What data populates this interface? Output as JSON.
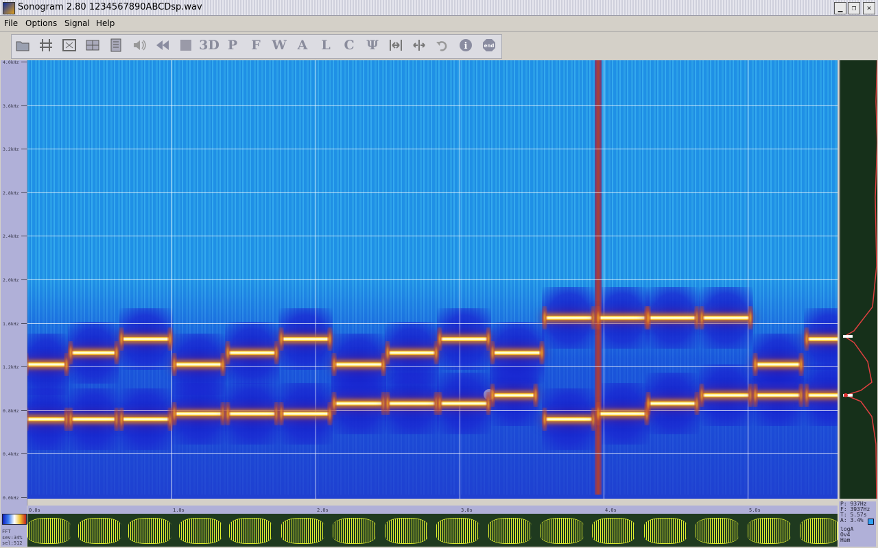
{
  "window": {
    "title": "Sonogram 2.80  1234567890ABCDsp.wav",
    "buttons": [
      "minimize-icon",
      "restore-icon",
      "close-icon"
    ]
  },
  "menu": [
    {
      "label": "File"
    },
    {
      "label": "Options"
    },
    {
      "label": "Signal"
    },
    {
      "label": "Help"
    }
  ],
  "toolbar": [
    {
      "icon": "open-file-icon",
      "label": ""
    },
    {
      "icon": "settings-icon",
      "label": ""
    },
    {
      "icon": "fit-window-icon",
      "label": ""
    },
    {
      "icon": "layout-icon",
      "label": ""
    },
    {
      "icon": "list-icon",
      "label": ""
    },
    {
      "icon": "speaker-icon",
      "label": ""
    },
    {
      "icon": "rewind-icon",
      "label": ""
    },
    {
      "icon": "stop-icon",
      "label": ""
    },
    {
      "icon": "3d-icon",
      "label": "3D"
    },
    {
      "icon": "p-icon",
      "label": "P"
    },
    {
      "icon": "f-icon",
      "label": "F"
    },
    {
      "icon": "w-icon",
      "label": "W"
    },
    {
      "icon": "a-icon",
      "label": "A"
    },
    {
      "icon": "l-icon",
      "label": "L"
    },
    {
      "icon": "c-icon",
      "label": "C"
    },
    {
      "icon": "psi-icon",
      "label": "Ψ"
    },
    {
      "icon": "zoom-in-icon",
      "label": ""
    },
    {
      "icon": "zoom-out-icon",
      "label": ""
    },
    {
      "icon": "undo-icon",
      "label": ""
    },
    {
      "icon": "info-icon",
      "label": "i"
    },
    {
      "icon": "end-icon",
      "label": "end"
    }
  ],
  "yaxis": {
    "ticks": [
      "4.0kHz",
      "3.6kHz",
      "3.2kHz",
      "2.8kHz",
      "2.4kHz",
      "2.0kHz",
      "1.6kHz",
      "1.2kHz",
      "0.8kHz",
      "0.4kHz",
      "0.0kHz"
    ]
  },
  "timeaxis": {
    "ticks": [
      "0.0s",
      "1.0s",
      "2.0s",
      "3.0s",
      "4.0s",
      "5.0s"
    ]
  },
  "readout": {
    "f_peak": "P: 937Hz",
    "f_cursor": "F: 3937Hz",
    "time": "T: 5.57s",
    "amp": "A: 3.4%",
    "scale": "logA",
    "overlap": "Ov4",
    "window": "Ham"
  },
  "leftinfo": {
    "label": "FFT",
    "line1": "sev:34%",
    "line2": "sel:512"
  },
  "tones": {
    "high": [
      {
        "t": 0.0,
        "len": 0.26,
        "f": 1.22
      },
      {
        "t": 0.31,
        "len": 0.3,
        "f": 1.33
      },
      {
        "t": 0.66,
        "len": 0.32,
        "f": 1.45
      },
      {
        "t": 1.03,
        "len": 0.32,
        "f": 1.22
      },
      {
        "t": 1.4,
        "len": 0.32,
        "f": 1.33
      },
      {
        "t": 1.77,
        "len": 0.32,
        "f": 1.45
      },
      {
        "t": 2.14,
        "len": 0.32,
        "f": 1.22
      },
      {
        "t": 2.51,
        "len": 0.32,
        "f": 1.33
      },
      {
        "t": 2.87,
        "len": 0.32,
        "f": 1.45
      },
      {
        "t": 3.24,
        "len": 0.32,
        "f": 1.33
      },
      {
        "t": 3.6,
        "len": 0.32,
        "f": 1.65
      },
      {
        "t": 3.97,
        "len": 0.32,
        "f": 1.65
      },
      {
        "t": 4.32,
        "len": 0.32,
        "f": 1.65
      },
      {
        "t": 4.69,
        "len": 0.32,
        "f": 1.65
      },
      {
        "t": 5.06,
        "len": 0.3,
        "f": 1.22
      },
      {
        "t": 5.42,
        "len": 0.3,
        "f": 1.45
      }
    ],
    "low": [
      {
        "t": 0.0,
        "len": 0.26,
        "f": 0.72
      },
      {
        "t": 0.31,
        "len": 0.3,
        "f": 0.72
      },
      {
        "t": 0.66,
        "len": 0.32,
        "f": 0.72
      },
      {
        "t": 1.03,
        "len": 0.32,
        "f": 0.77
      },
      {
        "t": 1.4,
        "len": 0.32,
        "f": 0.77
      },
      {
        "t": 1.77,
        "len": 0.32,
        "f": 0.77
      },
      {
        "t": 2.14,
        "len": 0.32,
        "f": 0.86
      },
      {
        "t": 2.51,
        "len": 0.32,
        "f": 0.86
      },
      {
        "t": 2.87,
        "len": 0.32,
        "f": 0.86
      },
      {
        "t": 3.24,
        "len": 0.28,
        "f": 0.94
      },
      {
        "t": 3.6,
        "len": 0.32,
        "f": 0.72
      },
      {
        "t": 3.97,
        "len": 0.32,
        "f": 0.77
      },
      {
        "t": 4.32,
        "len": 0.32,
        "f": 0.86
      },
      {
        "t": 4.69,
        "len": 0.32,
        "f": 0.94
      },
      {
        "t": 5.06,
        "len": 0.3,
        "f": 0.94
      },
      {
        "t": 5.42,
        "len": 0.3,
        "f": 0.94
      }
    ]
  },
  "waveform_segments": [
    {
      "t": 0.0,
      "len": 0.3
    },
    {
      "t": 0.35,
      "len": 0.3
    },
    {
      "t": 0.7,
      "len": 0.3
    },
    {
      "t": 1.05,
      "len": 0.3
    },
    {
      "t": 1.4,
      "len": 0.3
    },
    {
      "t": 1.76,
      "len": 0.3
    },
    {
      "t": 2.12,
      "len": 0.3
    },
    {
      "t": 2.48,
      "len": 0.3
    },
    {
      "t": 2.84,
      "len": 0.3
    },
    {
      "t": 3.2,
      "len": 0.3
    },
    {
      "t": 3.56,
      "len": 0.3
    },
    {
      "t": 3.92,
      "len": 0.3
    },
    {
      "t": 4.28,
      "len": 0.3
    },
    {
      "t": 4.64,
      "len": 0.3
    },
    {
      "t": 5.0,
      "len": 0.3
    },
    {
      "t": 5.36,
      "len": 0.28
    }
  ]
}
